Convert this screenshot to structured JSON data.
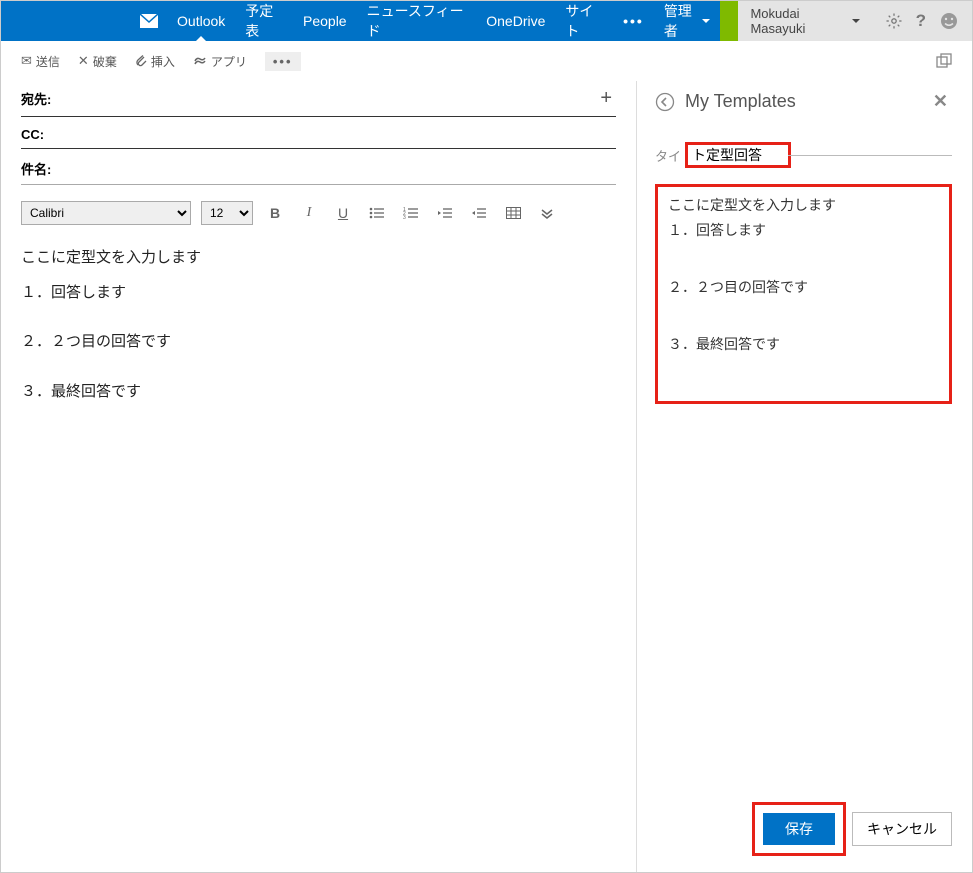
{
  "topnav": {
    "items": [
      "Outlook",
      "予定表",
      "People",
      "ニュースフィード",
      "OneDrive",
      "サイト"
    ],
    "dots": "•••",
    "admin": "管理者",
    "user": "Mokudai Masayuki"
  },
  "actions": {
    "send": "送信",
    "discard": "破棄",
    "insert": "挿入",
    "apps": "アプリ",
    "more": "•••"
  },
  "compose": {
    "to_label": "宛先:",
    "cc_label": "CC:",
    "subject_label": "件名:",
    "font": "Calibri",
    "size": "12",
    "body_lines": [
      "ここに定型文を入力します",
      "１．回答します",
      "",
      "２．２つ目の回答です",
      "",
      "３．最終回答です"
    ]
  },
  "panel": {
    "title": "My Templates",
    "title_label": "タイ",
    "title_value": "ト定型回答",
    "body_intro": "ここに定型文を入力します",
    "body_lines": [
      "１．回答します",
      "２．２つ目の回答です",
      "３．最終回答です"
    ],
    "save": "保存",
    "cancel": "キャンセル"
  }
}
